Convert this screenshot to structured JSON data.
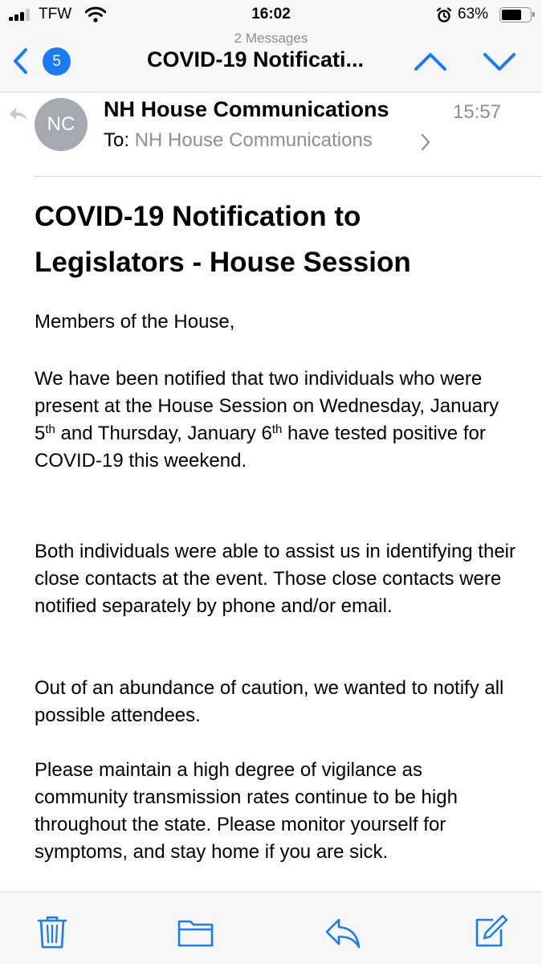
{
  "status_bar": {
    "carrier": "TFW",
    "time": "16:02",
    "battery_percent": "63%",
    "battery_level": 0.63,
    "icons": [
      "signal-icon",
      "wifi-icon",
      "alarm-icon",
      "battery-icon"
    ]
  },
  "nav": {
    "back_icon": "chevron-left-icon",
    "unread_count": "5",
    "message_count": "2 Messages",
    "title": "COVID-19 Notificati...",
    "prev_icon": "chevron-up-icon",
    "next_icon": "chevron-down-icon"
  },
  "message": {
    "avatar_initials": "NC",
    "sender": "NH House Communications",
    "time": "15:57",
    "to_label": "To:",
    "to_recipient": "NH House Communications",
    "subject": "COVID-19 Notification to Legislators - House Session",
    "greeting": "Members of the House,",
    "p1": {
      "part1": "We have been notified that two individuals who were present at the House Session on Wednesday, January 5",
      "sup1": "th",
      "part2": " and Thursday, January 6",
      "sup2": "th",
      "part3": " have tested positive for COVID-19 this weekend."
    },
    "p2": "Both individuals were able to assist us in identifying their close contacts at the event. Those close contacts were notified separately by phone and/or email.",
    "p3": "Out of an abundance of caution, we wanted to notify all possible attendees.",
    "p4": "Please maintain a high degree of vigilance as community transmission rates continue to be high throughout the state. Please monitor yourself for symptoms, and stay home if you are sick."
  },
  "toolbar": {
    "icons": [
      "trash-icon",
      "folder-icon",
      "reply-icon",
      "compose-icon"
    ]
  },
  "colors": {
    "accent": "#1a7cf5",
    "secondary_text": "#8e8e93",
    "chrome_bg": "#f7f7f7"
  }
}
